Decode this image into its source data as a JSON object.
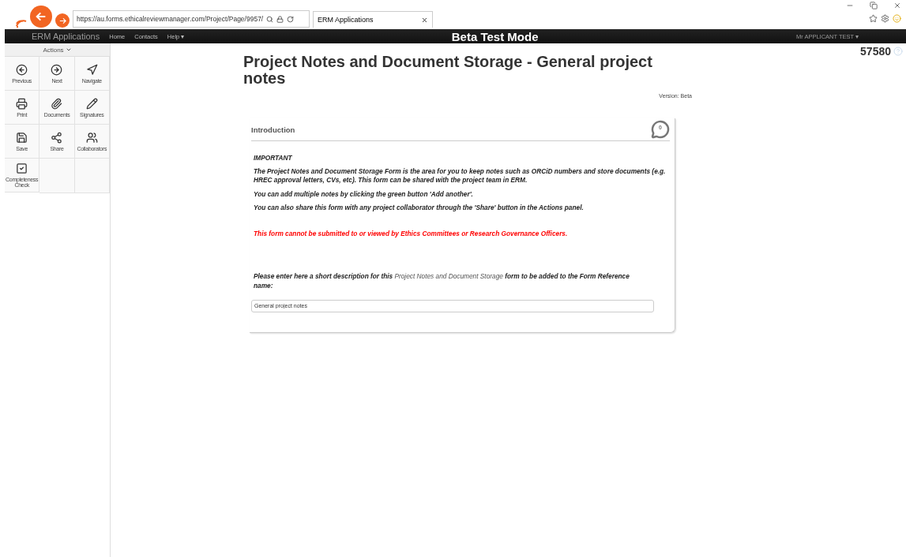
{
  "browser": {
    "address": "https://au.forms.ethicalreviewmanager.com/Project/Page/9957/",
    "tab_title": "ERM Applications"
  },
  "navbar": {
    "brand": "ERM Applications",
    "links": [
      "Home",
      "Contacts",
      "Help ▾"
    ],
    "mode": "Beta Test Mode",
    "user": "Mr APPLICANT TEST ▾"
  },
  "sidebar": {
    "header": "Actions",
    "actions": [
      "Previous",
      "Next",
      "Navigate",
      "Print",
      "Documents",
      "Signatures",
      "Save",
      "Share",
      "Collaborators",
      "Completeness Check"
    ]
  },
  "project_number": "57580",
  "page": {
    "title": "Project Notes and Document Storage - General project notes",
    "version": "Version: Beta"
  },
  "section": {
    "title": "Introduction",
    "comment_count": "0",
    "heading": "IMPORTANT",
    "paragraphs": [
      "The Project Notes and Document Storage Form is the area for you to keep notes such as ORCiD numbers and store documents (e.g. HREC approval letters, CVs, etc). This form can be shared with the project team in ERM.",
      "You can add multiple notes by clicking the green button 'Add another'.",
      "You can also share this form with any project collaborator through the 'Share' button in the Actions panel."
    ],
    "warning": "This form cannot be submitted to or viewed by Ethics Committees or Research Governance Officers.",
    "question": "**Please enter here a short description for this** Project Notes and Document Storage **form to be added to the Form Reference name:**",
    "answer": "General project notes"
  }
}
